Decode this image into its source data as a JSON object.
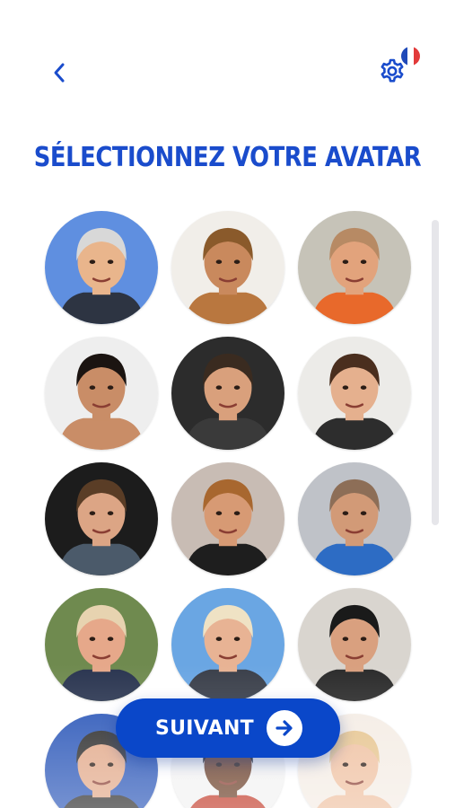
{
  "header": {
    "back_icon": "chevron-left-icon",
    "settings_icon": "gear-icon",
    "language_flag": {
      "name": "france-flag-icon",
      "colors": [
        "#1f49b8",
        "#ffffff",
        "#e23a3a"
      ]
    }
  },
  "title": "SÉLECTIONNEZ VOTRE AVATAR",
  "avatars": [
    {
      "bg": "#5f8fe0",
      "skin": "#e9b58c",
      "hair": "#d8d8d8",
      "shirt": "#2d3442"
    },
    {
      "bg": "#f1eee9",
      "skin": "#c9895d",
      "hair": "#8a5a2b",
      "shirt": "#b9773f"
    },
    {
      "bg": "#c6c3b8",
      "skin": "#e2a37c",
      "hair": "#b78a64",
      "shirt": "#e8692b"
    },
    {
      "bg": "#eeeeee",
      "skin": "#c98d67",
      "hair": "#1b1411",
      "shirt": "#c98d67"
    },
    {
      "bg": "#2c2c2c",
      "skin": "#d9a07c",
      "hair": "#3a2b20",
      "shirt": "#3a3a3a"
    },
    {
      "bg": "#ecebe8",
      "skin": "#e5b08e",
      "hair": "#4a2e1e",
      "shirt": "#2d2d2d"
    },
    {
      "bg": "#1c1c1c",
      "skin": "#dca585",
      "hair": "#5a3d26",
      "shirt": "#4b5a6a"
    },
    {
      "bg": "#c8bcb4",
      "skin": "#d79a74",
      "hair": "#a8672f",
      "shirt": "#1e1e1e"
    },
    {
      "bg": "#bfc2c8",
      "skin": "#d29a77",
      "hair": "#8d6e57",
      "shirt": "#2d6cc4"
    },
    {
      "bg": "#6f8a4f",
      "skin": "#e6a88a",
      "hair": "#e7d3b0",
      "shirt": "#2a3550"
    },
    {
      "bg": "#6aa6e3",
      "skin": "#e8b394",
      "hair": "#efe2c4",
      "shirt": "#3a3f4a"
    },
    {
      "bg": "#d9d5cf",
      "skin": "#d9a07f",
      "hair": "#1a1a1a",
      "shirt": "#2b2b2b"
    },
    {
      "bg": "#2a56b8",
      "skin": "#e2a98a",
      "hair": "#2a2a2a",
      "shirt": "#2a2a2a"
    },
    {
      "bg": "#f2f2f2",
      "skin": "#6b3f28",
      "hair": "#1a1a1a",
      "shirt": "#c23b2a"
    },
    {
      "bg": "#f4ece4",
      "skin": "#efc0a0",
      "hair": "#e6c48e",
      "shirt": "#efc0a0"
    }
  ],
  "next_button": {
    "label": "SUIVANT",
    "icon": "arrow-right-icon"
  }
}
